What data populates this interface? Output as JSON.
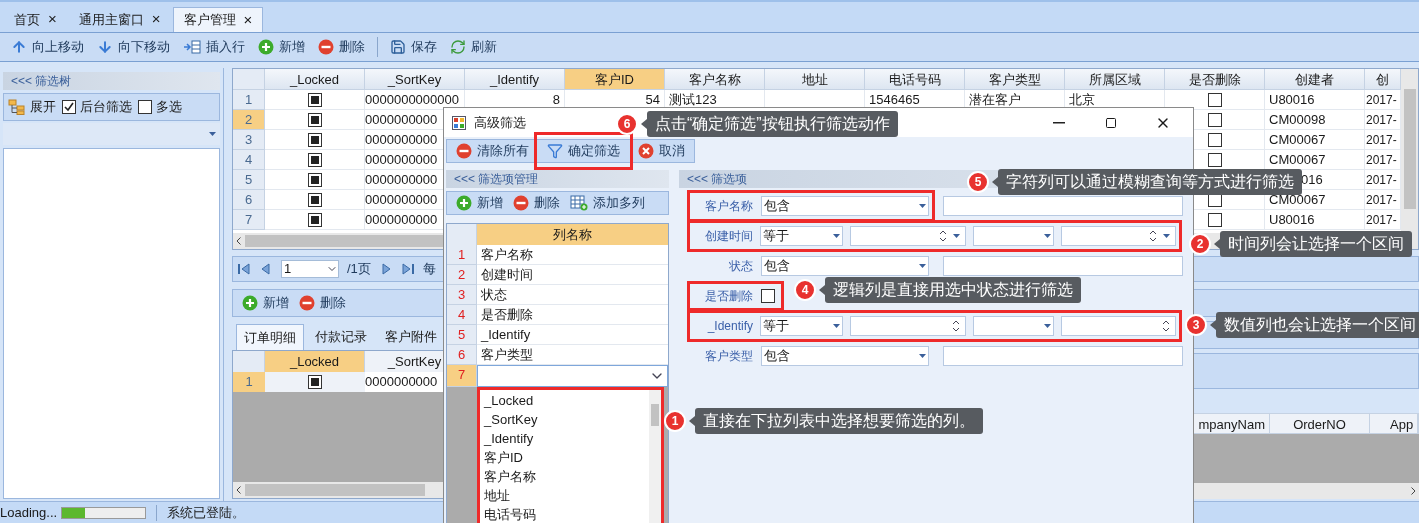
{
  "tabs": [
    {
      "label": "首页",
      "close": "×",
      "selected": false
    },
    {
      "label": "通用主窗口",
      "close": "×",
      "selected": false
    },
    {
      "label": "客户管理",
      "close": "×",
      "selected": true
    }
  ],
  "toolbar": [
    {
      "kind": "up",
      "label": "向上移动"
    },
    {
      "kind": "down",
      "label": "向下移动"
    },
    {
      "kind": "insert",
      "label": "插入行"
    },
    {
      "kind": "add",
      "label": "新增"
    },
    {
      "kind": "remove",
      "label": "删除"
    },
    {
      "kind": "separator"
    },
    {
      "kind": "save",
      "label": "保存"
    },
    {
      "kind": "refresh",
      "label": "刷新"
    }
  ],
  "filter_tree": {
    "title": "<<< 筛选树",
    "expand": "展开",
    "options": [
      {
        "label": "后台筛选",
        "checked": true
      },
      {
        "label": "多选",
        "checked": false
      }
    ]
  },
  "main_grid": {
    "columns": [
      {
        "label": "_Locked",
        "kind": "check",
        "selected": false
      },
      {
        "label": "_SortKey",
        "kind": "text",
        "selected": false
      },
      {
        "label": "_Identify",
        "kind": "number",
        "selected": false
      },
      {
        "label": "客户ID",
        "kind": "number",
        "selected": true
      },
      {
        "label": "客户名称",
        "kind": "text",
        "selected": false
      },
      {
        "label": "地址",
        "kind": "text",
        "selected": false
      },
      {
        "label": "电话号码",
        "kind": "text",
        "selected": false
      },
      {
        "label": "客户类型",
        "kind": "text",
        "selected": false
      },
      {
        "label": "所属区域",
        "kind": "text",
        "selected": false
      },
      {
        "label": "是否删除",
        "kind": "check",
        "selected": false
      },
      {
        "label": "创建者",
        "kind": "text",
        "selected": false
      },
      {
        "label": "创",
        "kind": "text",
        "selected": false
      }
    ],
    "rows": [
      {
        "num": "1",
        "selected": false,
        "locked": true,
        "sort_key": "0000000000000",
        "identify": "8",
        "customer_id": "54",
        "name": "测试123",
        "phone": "1546465",
        "type": "潜在客户",
        "region": "北京",
        "deleted": false,
        "creator": "U80016",
        "created": "2017-"
      },
      {
        "num": "2",
        "selected": true,
        "locked": true,
        "sort_key": "0000000000",
        "deleted": false,
        "creator": "CM00098",
        "created": "2017-"
      },
      {
        "num": "3",
        "selected": false,
        "locked": true,
        "sort_key": "0000000000",
        "deleted": false,
        "creator": "CM00067",
        "created": "2017-"
      },
      {
        "num": "4",
        "selected": false,
        "locked": true,
        "sort_key": "0000000000",
        "deleted": false,
        "creator": "CM00067",
        "created": "2017-"
      },
      {
        "num": "5",
        "selected": false,
        "locked": true,
        "sort_key": "0000000000",
        "creator": "016",
        "created": "2017-"
      },
      {
        "num": "6",
        "selected": false,
        "locked": true,
        "sort_key": "0000000000",
        "deleted": false,
        "creator": "CM00067",
        "created": "2017-"
      },
      {
        "num": "7",
        "selected": false,
        "locked": true,
        "sort_key": "0000000000",
        "deleted": false,
        "creator": "U80016",
        "created": "2017-"
      }
    ]
  },
  "pager": {
    "page": "1",
    "total": "/1页",
    "per_page": "每"
  },
  "detail": {
    "toolbar": [
      {
        "kind": "add",
        "label": "新增"
      },
      {
        "kind": "remove",
        "label": "删除"
      }
    ],
    "tabs": [
      {
        "label": "订单明细",
        "selected": true
      },
      {
        "label": "付款记录",
        "selected": false
      },
      {
        "label": "客户附件",
        "selected": false
      }
    ],
    "columns": [
      {
        "label": "_Locked",
        "selected": true
      },
      {
        "label": "_SortKey",
        "selected": false
      }
    ],
    "rows": [
      {
        "num": "1",
        "selected": true,
        "locked": true,
        "sort_key": "0000000000"
      }
    ],
    "right_columns": [
      "mpanyNam",
      "OrderNO",
      "App"
    ]
  },
  "status_bar": {
    "text": "Loading...",
    "level": 0.27,
    "message": "系统已登陆。"
  },
  "dialog": {
    "title": "高级筛选",
    "toolbar": [
      {
        "kind": "remove",
        "label": "清除所有",
        "highlighted": false
      },
      {
        "kind": "filter",
        "label": "确定筛选",
        "highlighted": true
      },
      {
        "kind": "cancel",
        "label": "取消",
        "highlighted": false
      }
    ],
    "manage_panel": {
      "title": "<<< 筛选项管理",
      "toolbar": [
        {
          "kind": "add",
          "label": "新增"
        },
        {
          "kind": "remove",
          "label": "删除"
        },
        {
          "kind": "multi",
          "label": "添加多列"
        }
      ],
      "column_header": "列名称",
      "rows": [
        {
          "num": "1",
          "name": "客户名称",
          "selected": false
        },
        {
          "num": "2",
          "name": "创建时间",
          "selected": false
        },
        {
          "num": "3",
          "name": "状态",
          "selected": false
        },
        {
          "num": "4",
          "name": "是否删除",
          "selected": false
        },
        {
          "num": "5",
          "name": "_Identify",
          "selected": false
        },
        {
          "num": "6",
          "name": "客户类型",
          "selected": false
        },
        {
          "num": "7",
          "selected": true
        }
      ],
      "dropdown": {
        "highlighted": true,
        "items": [
          "_Locked",
          "_SortKey",
          "_Identify",
          "客户ID",
          "客户名称",
          "地址",
          "电话号码"
        ]
      }
    },
    "filter_panel": {
      "title": "<<< 筛选项",
      "fields": [
        {
          "kind": "text",
          "label": "客户名称",
          "operator": "包含",
          "highlighted": true
        },
        {
          "kind": "date_range",
          "label": "创建时间",
          "operator": "等于",
          "highlighted": true
        },
        {
          "kind": "text",
          "label": "状态",
          "operator": "包含",
          "highlighted": false
        },
        {
          "kind": "checkbox",
          "label": "是否删除",
          "checked": false,
          "highlighted": true
        },
        {
          "kind": "number_range",
          "label": "_Identify",
          "operator": "等于",
          "highlighted": true
        },
        {
          "kind": "text",
          "label": "客户类型",
          "operator": "包含",
          "highlighted": false
        }
      ]
    }
  },
  "callouts": [
    {
      "number": "6",
      "text": "点击“确定筛选”按钮执行筛选动作"
    },
    {
      "number": "5",
      "text": "字符列可以通过模糊查询等方式进行筛选"
    },
    {
      "number": "2",
      "text": "时间列会让选择一个区间"
    },
    {
      "number": "4",
      "text": "逻辑列是直接用选中状态进行筛选"
    },
    {
      "number": "3",
      "text": "数值列也会让选择一个区间"
    },
    {
      "number": "1",
      "text": "直接在下拉列表中选择想要筛选的列。"
    }
  ]
}
